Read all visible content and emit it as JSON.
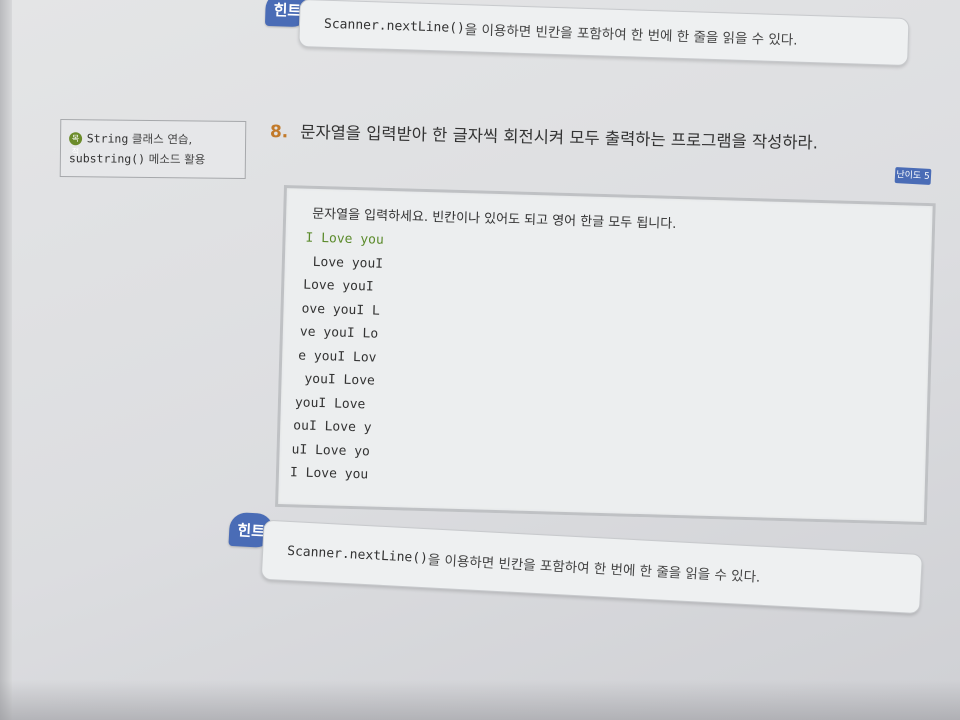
{
  "hint_top": {
    "badge": "힌트",
    "code": "Scanner.nextLine()",
    "text": "을 이용하면 빈칸을 포함하여 한 번에 한 줄을 읽을 수 있다."
  },
  "side_note": {
    "badge": "목적",
    "line1_code": "String",
    "line1_text": " 클래스 연습,",
    "line2_code": "substring()",
    "line2_text": " 메소드 활용"
  },
  "question": {
    "number": "8.",
    "text": "문자열을 입력받아 한 글자씩 회전시켜 모두 출력하는 프로그램을 작성하라."
  },
  "difficulty": "난이도 5",
  "output": {
    "prompt": "문자열을 입력하세요. 빈칸이나 있어도 되고 영어 한글 모두 됩니다.",
    "lines": [
      "I Love you",
      " Love youI",
      "Love youI",
      "ove youI L",
      "ve youI Lo",
      "e youI Lov",
      " youI Love",
      "youI Love",
      "ouI Love y",
      "uI Love yo",
      "I Love you"
    ]
  },
  "hint_bottom": {
    "badge": "힌트",
    "code": "Scanner.nextLine()",
    "text": "을 이용하면 빈칸을 포함하여 한 번에 한 줄을 읽을 수 있다."
  }
}
